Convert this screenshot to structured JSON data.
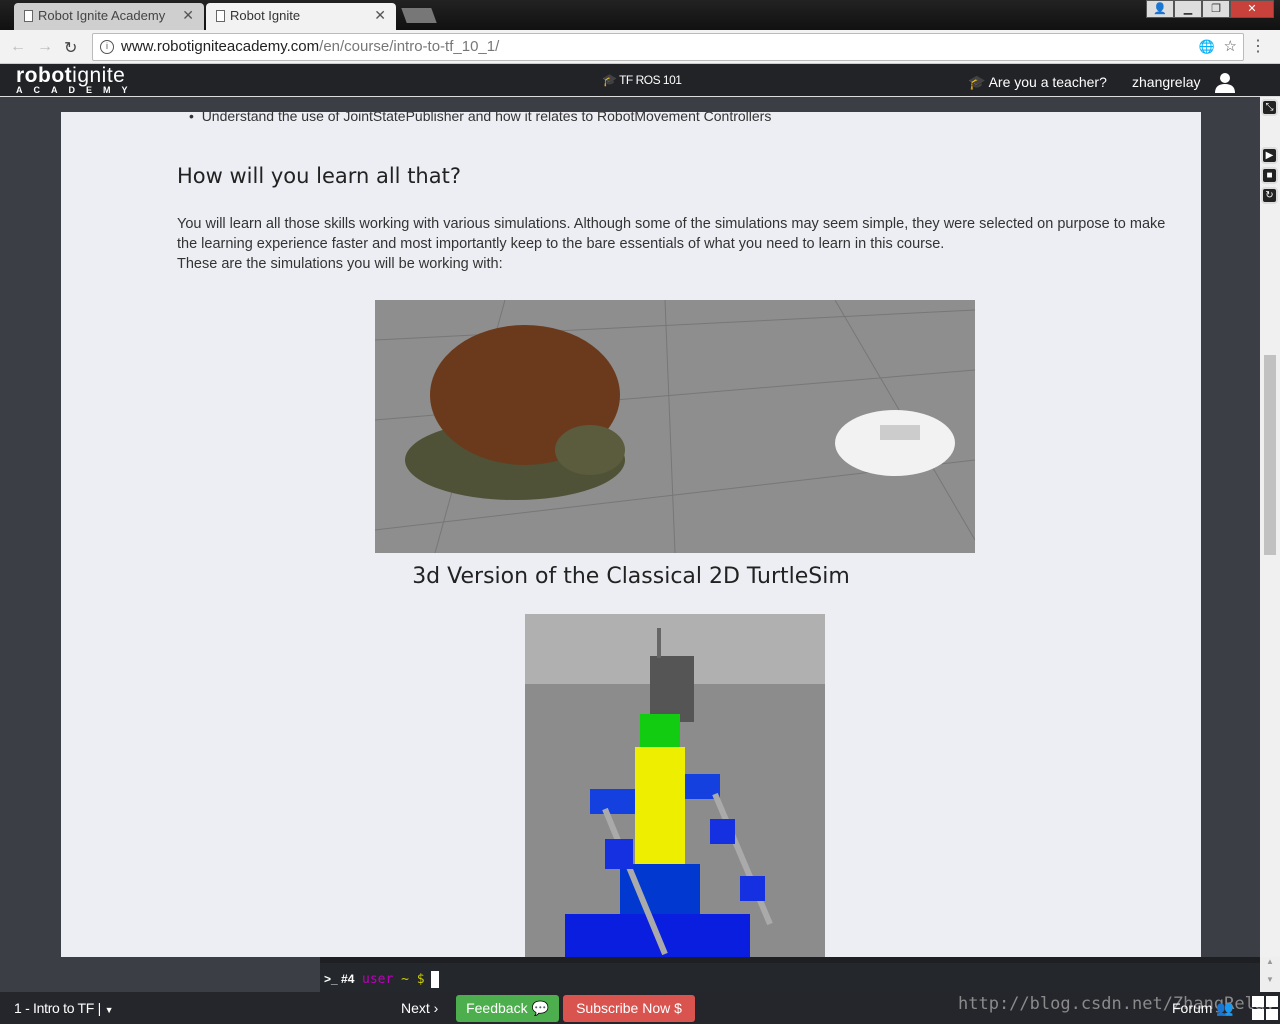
{
  "browser": {
    "tabs": [
      {
        "title": "Robot Ignite Academy"
      },
      {
        "title": "Robot Ignite"
      }
    ],
    "url_host": "www.robotigniteacademy.com",
    "url_path": "/en/course/intro-to-tf_10_1/"
  },
  "site": {
    "logo_main": "robot",
    "logo_accent": "ignite",
    "logo_sub": "ACADEMY",
    "course": "TF ROS 101",
    "teacher_link": "Are you a teacher?",
    "username": "zhangrelay"
  },
  "content": {
    "bullet": "Understand the use of JointStatePublisher and how it relates to RobotMovement Controllers",
    "heading": "How will you learn all that?",
    "paragraph1": "You will learn all those skills working with various simulations. Although some of the simulations may seem simple, they were selected on purpose to make the learning experience faster and most importantly keep to the bare essentials of what you need to learn in this course.",
    "paragraph2": "These are the simulations you will be working with:",
    "caption1": "3d Version of the Classical 2D TurtleSim"
  },
  "terminal": {
    "tab": ">_ #4",
    "prompt_user": "user",
    "prompt_rest": "~ $"
  },
  "bottom": {
    "chapter": "1 - Intro to TF |",
    "next": "Next ›",
    "feedback": "Feedback",
    "subscribe": "Subscribe Now $",
    "forum": "Forum",
    "watermark": "http://blog.csdn.net/ZhangRelay"
  },
  "colors": {
    "feedback": "#4cae4c",
    "subscribe": "#d9534f",
    "nav": "#222327"
  }
}
